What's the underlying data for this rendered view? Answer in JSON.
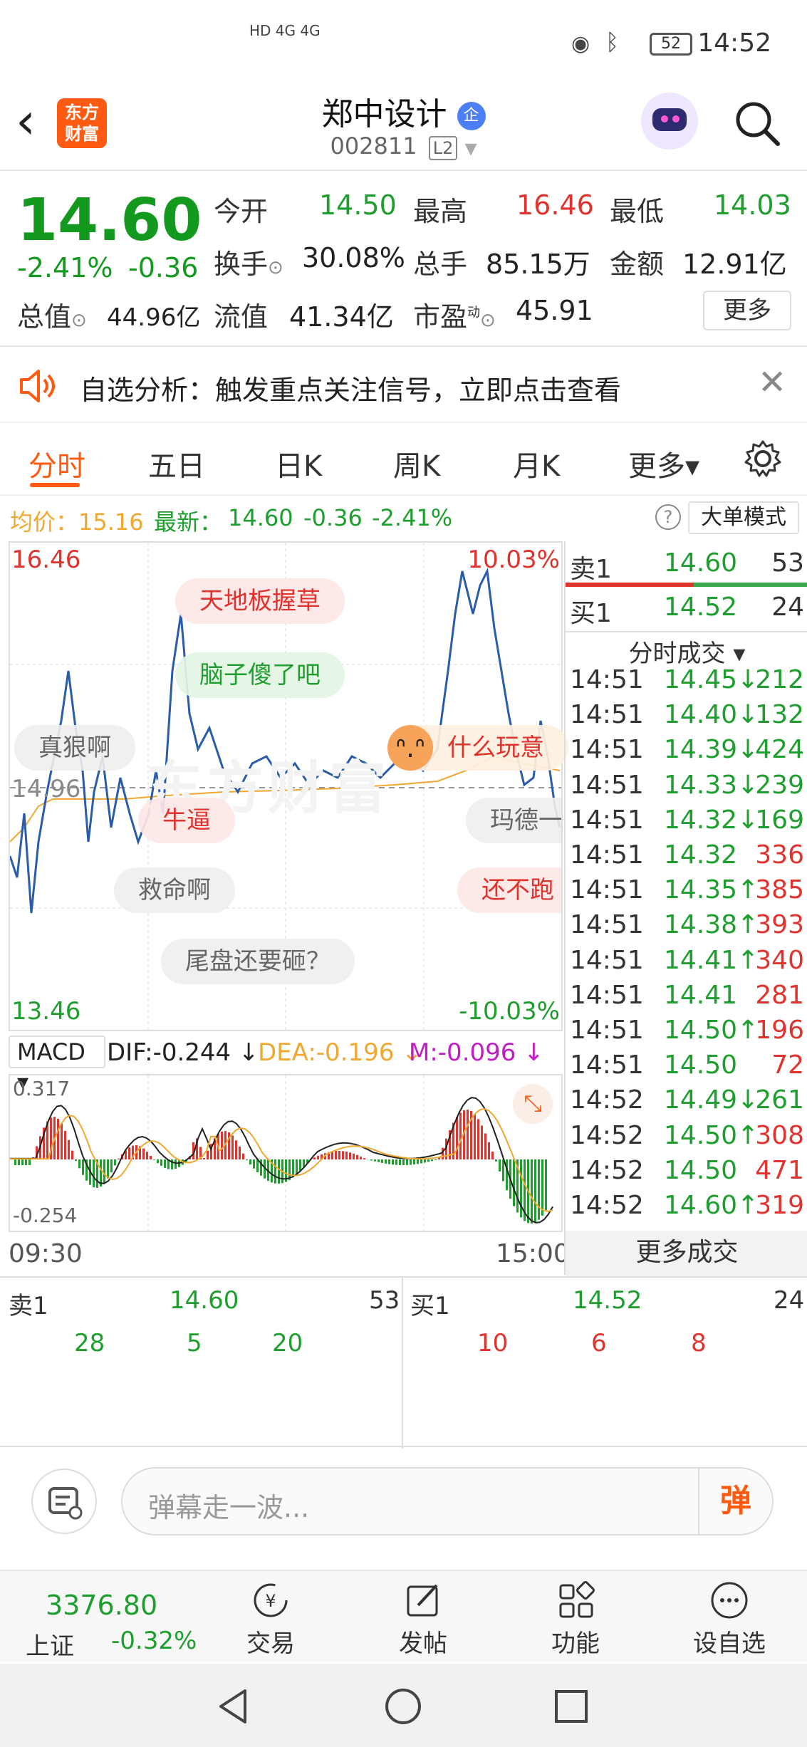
{
  "status_bar": {
    "time": "14:52",
    "battery": "52",
    "signal": "HD 4G 4G"
  },
  "header": {
    "logo_text": "东方\n财富",
    "stock_name": "郑中设计",
    "badge": "企",
    "stock_code": "002811",
    "tag": "L2"
  },
  "quote": {
    "price": "14.60",
    "change_pct": "-2.41%",
    "change_abs": "-0.36",
    "rows": [
      [
        {
          "label": "今开",
          "value": "14.50",
          "color": "green"
        },
        {
          "label": "最高",
          "value": "16.46",
          "color": "red"
        },
        {
          "label": "最低",
          "value": "14.03",
          "color": "green"
        }
      ],
      [
        {
          "label": "换手",
          "value": "30.08%",
          "color": "dark"
        },
        {
          "label": "总手",
          "value": "85.15万",
          "color": "dark"
        },
        {
          "label": "金额",
          "value": "12.91亿",
          "color": "dark"
        }
      ],
      [
        {
          "label": "总值",
          "value": "44.96亿",
          "color": "dark"
        },
        {
          "label": "流值",
          "value": "41.34亿",
          "color": "dark"
        },
        {
          "label": "市盈",
          "value": "45.91",
          "color": "dark"
        }
      ]
    ],
    "pe_sup": "动",
    "more_label": "更多"
  },
  "banner": {
    "text": "自选分析：触发重点关注信号，立即点击查看"
  },
  "tabs": [
    "分时",
    "五日",
    "日K",
    "周K",
    "月K",
    "更多▾"
  ],
  "infobar": {
    "avg_label": "均价：15.16",
    "latest_label": "最新：",
    "latest": "14.60",
    "chg": "-0.36",
    "pct": "-2.41%",
    "big_order": "大单模式",
    "help": "?"
  },
  "chart": {
    "hi_price": "16.46",
    "lo_price": "13.46",
    "hi_pct": "10.03%",
    "lo_pct": "-10.03%",
    "ref_price": "14.96",
    "danmaku": [
      {
        "text": "天地板握草",
        "color": "#e0332e",
        "bg": "#fde7e6"
      },
      {
        "text": "脑子傻了吧",
        "color": "#1e9e2e",
        "bg": "#e4f5e4"
      },
      {
        "text": "真狠啊",
        "color": "#666",
        "bg": "#eeeeee"
      },
      {
        "text": "什么玩意",
        "color": "#e0332e",
        "bg": "#fdf0e0"
      },
      {
        "text": "牛逼",
        "color": "#e0332e",
        "bg": "#fde7e6"
      },
      {
        "text": "玛德一",
        "color": "#666",
        "bg": "#eeeeee"
      },
      {
        "text": "救命啊",
        "color": "#666",
        "bg": "#eeeeee"
      },
      {
        "text": "还不跑",
        "color": "#e0332e",
        "bg": "#fde7e6"
      },
      {
        "text": "尾盘还要砸？",
        "color": "#666",
        "bg": "#eeeeee"
      }
    ],
    "watermark": "东方财富"
  },
  "macd": {
    "selector": "MACD ▾",
    "dif": "DIF:-0.244 ↓",
    "dea": "DEA:-0.196 ↓",
    "m": "M:-0.096 ↓",
    "top": "0.317",
    "bottom": "-0.254"
  },
  "axis": {
    "start": "09:30",
    "end": "15:00"
  },
  "book_side": {
    "ask_label": "卖1",
    "ask_price": "14.60",
    "ask_vol": "53",
    "bid_label": "买1",
    "bid_price": "14.52",
    "bid_vol": "24",
    "deals_title": "分时成交 ▾",
    "more_deals": "更多成交"
  },
  "ticks": [
    {
      "t": "14:51",
      "p": "14.45↓",
      "v": "212",
      "c": "green",
      "vc": "green"
    },
    {
      "t": "14:51",
      "p": "14.40↓",
      "v": "132",
      "c": "green",
      "vc": "green"
    },
    {
      "t": "14:51",
      "p": "14.39↓",
      "v": "424",
      "c": "green",
      "vc": "green"
    },
    {
      "t": "14:51",
      "p": "14.33↓",
      "v": "239",
      "c": "green",
      "vc": "green"
    },
    {
      "t": "14:51",
      "p": "14.32↓",
      "v": "169",
      "c": "green",
      "vc": "green"
    },
    {
      "t": "14:51",
      "p": "14.32",
      "v": "336",
      "c": "green",
      "vc": "red"
    },
    {
      "t": "14:51",
      "p": "14.35↑",
      "v": "385",
      "c": "green",
      "vc": "red"
    },
    {
      "t": "14:51",
      "p": "14.38↑",
      "v": "393",
      "c": "green",
      "vc": "red"
    },
    {
      "t": "14:51",
      "p": "14.41↑",
      "v": "340",
      "c": "green",
      "vc": "red"
    },
    {
      "t": "14:51",
      "p": "14.41",
      "v": "281",
      "c": "green",
      "vc": "red"
    },
    {
      "t": "14:51",
      "p": "14.50↑",
      "v": "196",
      "c": "green",
      "vc": "red"
    },
    {
      "t": "14:51",
      "p": "14.50",
      "v": "72",
      "c": "green",
      "vc": "red"
    },
    {
      "t": "14:52",
      "p": "14.49↓",
      "v": "261",
      "c": "green",
      "vc": "green"
    },
    {
      "t": "14:52",
      "p": "14.50↑",
      "v": "308",
      "c": "green",
      "vc": "red"
    },
    {
      "t": "14:52",
      "p": "14.50",
      "v": "471",
      "c": "green",
      "vc": "red"
    },
    {
      "t": "14:52",
      "p": "14.60↑",
      "v": "319",
      "c": "green",
      "vc": "red"
    }
  ],
  "depth": {
    "ask_label": "卖1",
    "ask_price": "14.60",
    "ask_vol": "53",
    "ask_queue": [
      "28",
      "5",
      "20"
    ],
    "bid_label": "买1",
    "bid_price": "14.52",
    "bid_vol": "24",
    "bid_queue": [
      "10",
      "6",
      "8"
    ]
  },
  "input": {
    "placeholder": "弹幕走一波...",
    "send": "弹"
  },
  "bottom_nav": {
    "index_value": "3376.80",
    "index_name": "上证",
    "index_pct": "-0.32%",
    "items": [
      "交易",
      "发帖",
      "功能",
      "设自选"
    ]
  },
  "colors": {
    "accent": "#ff5a12",
    "up": "#e0332e",
    "down": "#1e9e2e",
    "avg_line": "#f0a830",
    "price_line": "#2a5caa"
  }
}
